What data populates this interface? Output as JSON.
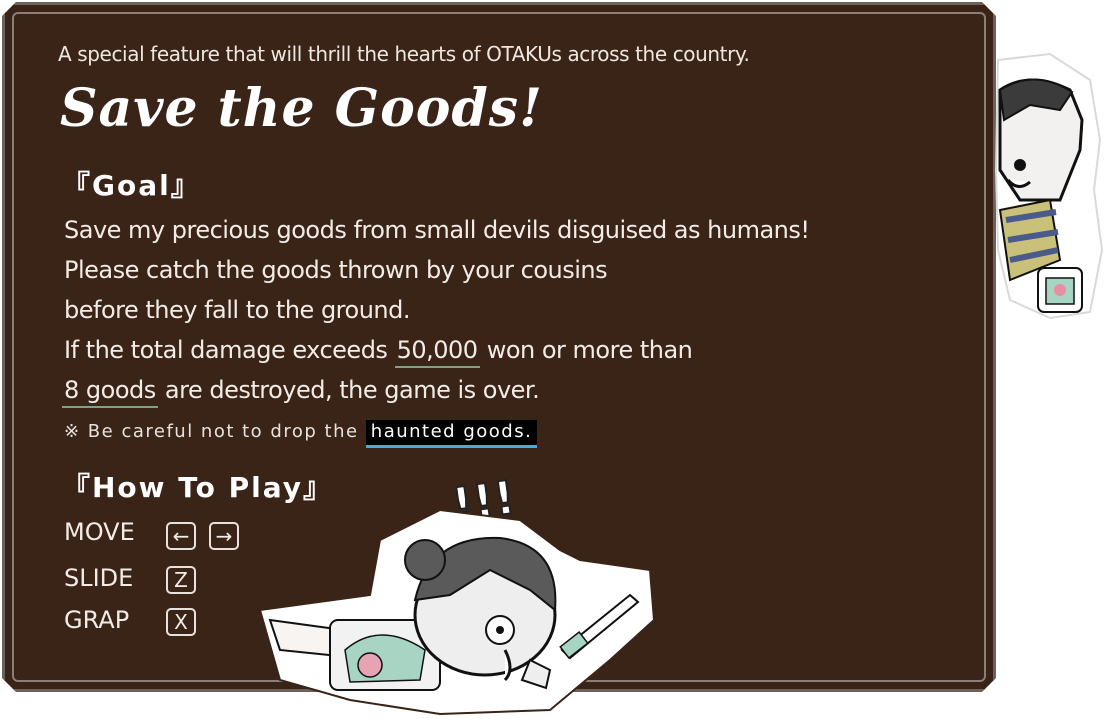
{
  "subtitle": "A special feature that will thrill the hearts of OTAKUs across the country.",
  "title": "Save the Goods!",
  "goal": {
    "heading": "『Goal』",
    "line1": "Save my precious goods from small devils disguised as humans!",
    "line2": "Please catch the goods thrown by your cousins",
    "line3": "before they fall to the ground.",
    "line4_pre": "If the total damage exceeds",
    "line4_hl": "50,000",
    "line4_post": "won or more than",
    "line5_hl": "8 goods",
    "line5_post": "are destroyed, the game is over.",
    "note_pre": "※ Be careful not to drop the",
    "note_hl": "haunted goods."
  },
  "how_to_play": {
    "heading": "『How To Play』",
    "controls": [
      {
        "label": "MOVE",
        "keys": [
          "←",
          "→"
        ]
      },
      {
        "label": "SLIDE",
        "keys": [
          "Z"
        ]
      },
      {
        "label": "GRAP",
        "keys": [
          "X"
        ]
      }
    ]
  },
  "exclaim": "!!!",
  "colors": {
    "board": "#3a2418",
    "board_border": "#6c625b",
    "text": "#f3ece6",
    "underline": "#7fa08a",
    "haunted_underline": "#3fb0d8"
  },
  "icons": [
    "cousin-character-icon",
    "girl-sliding-character-icon"
  ]
}
